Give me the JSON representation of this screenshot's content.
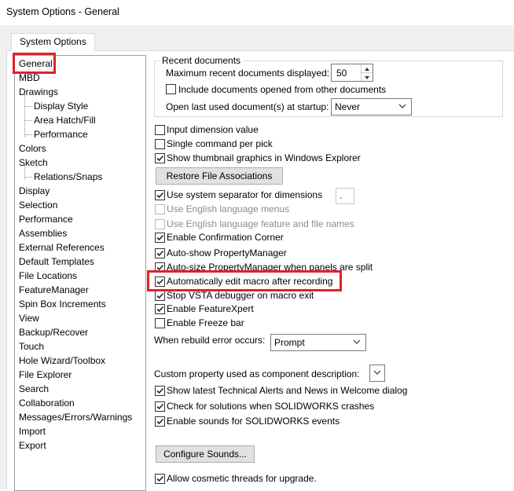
{
  "window": {
    "title": "System Options - General"
  },
  "tab": {
    "label": "System Options"
  },
  "tree": {
    "items": [
      {
        "label": "General",
        "level": 0,
        "selected": true
      },
      {
        "label": "MBD",
        "level": 0
      },
      {
        "label": "Drawings",
        "level": 0
      },
      {
        "label": "Display Style",
        "level": 1
      },
      {
        "label": "Area Hatch/Fill",
        "level": 1
      },
      {
        "label": "Performance",
        "level": 1
      },
      {
        "label": "Colors",
        "level": 0
      },
      {
        "label": "Sketch",
        "level": 0
      },
      {
        "label": "Relations/Snaps",
        "level": 1
      },
      {
        "label": "Display",
        "level": 0
      },
      {
        "label": "Selection",
        "level": 0
      },
      {
        "label": "Performance",
        "level": 0
      },
      {
        "label": "Assemblies",
        "level": 0
      },
      {
        "label": "External References",
        "level": 0
      },
      {
        "label": "Default Templates",
        "level": 0
      },
      {
        "label": "File Locations",
        "level": 0
      },
      {
        "label": "FeatureManager",
        "level": 0
      },
      {
        "label": "Spin Box Increments",
        "level": 0
      },
      {
        "label": "View",
        "level": 0
      },
      {
        "label": "Backup/Recover",
        "level": 0
      },
      {
        "label": "Touch",
        "level": 0
      },
      {
        "label": "Hole Wizard/Toolbox",
        "level": 0
      },
      {
        "label": "File Explorer",
        "level": 0
      },
      {
        "label": "Search",
        "level": 0
      },
      {
        "label": "Collaboration",
        "level": 0
      },
      {
        "label": "Messages/Errors/Warnings",
        "level": 0
      },
      {
        "label": "Import",
        "level": 0
      },
      {
        "label": "Export",
        "level": 0
      }
    ]
  },
  "recent": {
    "legend": "Recent documents",
    "max_label": "Maximum recent documents displayed:",
    "max_value": "50",
    "include_label": "Include documents opened from other documents",
    "include_checked": false,
    "open_last_label": "Open last used document(s) at startup:",
    "open_last_value": "Never"
  },
  "options": [
    {
      "label": "Input dimension value",
      "checked": false,
      "enabled": true
    },
    {
      "label": "Single command per pick",
      "checked": false,
      "enabled": true
    },
    {
      "label": "Show thumbnail graphics in Windows Explorer",
      "checked": true,
      "enabled": true
    },
    {
      "label": "Use system separator for dimensions",
      "checked": true,
      "enabled": true
    },
    {
      "label": "Use English language menus",
      "checked": false,
      "enabled": false
    },
    {
      "label": "Use English language feature and file names",
      "checked": false,
      "enabled": false
    },
    {
      "label": "Enable Confirmation Corner",
      "checked": true,
      "enabled": true
    },
    {
      "label": "Auto-show PropertyManager",
      "checked": true,
      "enabled": true
    },
    {
      "label": "Auto-size PropertyManager when panels are split",
      "checked": true,
      "enabled": true
    },
    {
      "label": "Automatically edit macro after recording",
      "checked": true,
      "enabled": true
    },
    {
      "label": "Stop VSTA debugger on macro exit",
      "checked": true,
      "enabled": true
    },
    {
      "label": "Enable FeatureXpert",
      "checked": true,
      "enabled": true
    },
    {
      "label": "Enable Freeze bar",
      "checked": false,
      "enabled": true
    },
    {
      "label": "Show latest Technical Alerts and News in Welcome dialog",
      "checked": true,
      "enabled": true
    },
    {
      "label": "Check for solutions when SOLIDWORKS crashes",
      "checked": true,
      "enabled": true
    },
    {
      "label": "Enable sounds for SOLIDWORKS events",
      "checked": true,
      "enabled": true
    },
    {
      "label": "Allow cosmetic threads for upgrade.",
      "checked": true,
      "enabled": true
    }
  ],
  "separator_value": ".",
  "buttons": {
    "restore": "Restore File Associations",
    "sounds": "Configure Sounds..."
  },
  "rebuild": {
    "label": "When rebuild error occurs:",
    "value": "Prompt"
  },
  "custom_prop": {
    "label": "Custom property used as component description:",
    "value": ""
  },
  "highlight_color": "#e0202a"
}
